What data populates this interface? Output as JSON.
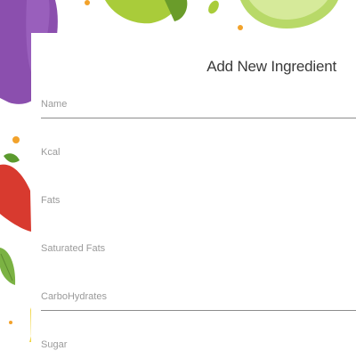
{
  "form": {
    "title": "Add New Ingredient",
    "fields": [
      {
        "label": "Name",
        "underlined": true
      },
      {
        "label": "Kcal",
        "underlined": false
      },
      {
        "label": "Fats",
        "underlined": false
      },
      {
        "label": "Saturated Fats",
        "underlined": false
      },
      {
        "label": "CarboHydrates",
        "underlined": true
      },
      {
        "label": "Sugar",
        "underlined": false
      }
    ]
  },
  "colors": {
    "purple_veg": "#8e4fae",
    "green_veg": "#a6c935",
    "red_pepper": "#d83a2f",
    "leaf": "#7bb243",
    "orange_dot": "#f2a22b"
  }
}
